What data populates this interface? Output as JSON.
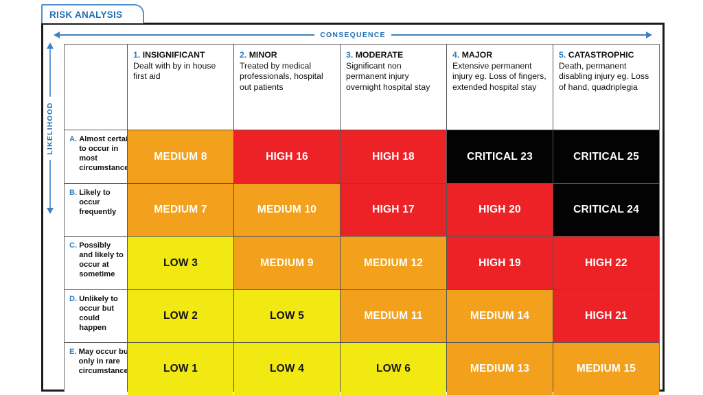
{
  "tab": {
    "label": "RISK ANALYSIS"
  },
  "axes": {
    "consequence": "CONSEQUENCE",
    "likelihood": "LIKELIHOOD"
  },
  "columns": [
    {
      "num": "1.",
      "title": "INSIGNIFICANT",
      "desc": "Dealt with by in house first aid"
    },
    {
      "num": "2.",
      "title": "MINOR",
      "desc": "Treated by medical professionals, hospital out patients"
    },
    {
      "num": "3.",
      "title": "MODERATE",
      "desc": "Significant non permanent injury overnight hospital stay"
    },
    {
      "num": "4.",
      "title": "MAJOR",
      "desc": "Extensive permanent injury  eg. Loss of fingers, extended hospital stay"
    },
    {
      "num": "5.",
      "title": "CATASTROPHIC",
      "desc": "Death, permanent disabling injury eg. Loss of hand, quadriplegia"
    }
  ],
  "rows": [
    {
      "num": "A.",
      "text": "Almost certain to occur in most circumstances"
    },
    {
      "num": "B.",
      "text": "Likely to occur frequently"
    },
    {
      "num": "C.",
      "text": "Possibly and likely to occur at sometime"
    },
    {
      "num": "D.",
      "text": "Unlikely to occur but could happen"
    },
    {
      "num": "E.",
      "text": "May occur but only in rare circumstances"
    }
  ],
  "legend_colors": {
    "low": "#f2e913",
    "medium": "#f3a01c",
    "high": "#ed2227",
    "critical": "#030303",
    "accent_blue": "#1f6fb4",
    "frame": "#1a1a1a"
  },
  "chart_data": {
    "type": "heatmap",
    "title": "RISK ANALYSIS",
    "xlabel": "CONSEQUENCE",
    "ylabel": "LIKELIHOOD",
    "categories_x": [
      "1. INSIGNIFICANT",
      "2. MINOR",
      "3. MODERATE",
      "4. MAJOR",
      "5. CATASTROPHIC"
    ],
    "categories_y": [
      "A. Almost certain",
      "B. Likely",
      "C. Possibly",
      "D. Unlikely",
      "E. May occur"
    ],
    "legend": [
      "LOW",
      "MEDIUM",
      "HIGH",
      "CRITICAL"
    ],
    "cells": [
      [
        {
          "level": "MEDIUM",
          "score": 8,
          "label": "MEDIUM 8",
          "color": "#f3a01c"
        },
        {
          "level": "HIGH",
          "score": 16,
          "label": "HIGH 16",
          "color": "#ed2227"
        },
        {
          "level": "HIGH",
          "score": 18,
          "label": "HIGH 18",
          "color": "#ed2227"
        },
        {
          "level": "CRITICAL",
          "score": 23,
          "label": "CRITICAL 23",
          "color": "#030303"
        },
        {
          "level": "CRITICAL",
          "score": 25,
          "label": "CRITICAL 25",
          "color": "#030303"
        }
      ],
      [
        {
          "level": "MEDIUM",
          "score": 7,
          "label": "MEDIUM 7",
          "color": "#f3a01c"
        },
        {
          "level": "MEDIUM",
          "score": 10,
          "label": "MEDIUM 10",
          "color": "#f3a01c"
        },
        {
          "level": "HIGH",
          "score": 17,
          "label": "HIGH 17",
          "color": "#ed2227"
        },
        {
          "level": "HIGH",
          "score": 20,
          "label": "HIGH 20",
          "color": "#ed2227"
        },
        {
          "level": "CRITICAL",
          "score": 24,
          "label": "CRITICAL 24",
          "color": "#030303"
        }
      ],
      [
        {
          "level": "LOW",
          "score": 3,
          "label": "LOW 3",
          "color": "#f2e913"
        },
        {
          "level": "MEDIUM",
          "score": 9,
          "label": "MEDIUM 9",
          "color": "#f3a01c"
        },
        {
          "level": "MEDIUM",
          "score": 12,
          "label": "MEDIUM 12",
          "color": "#f3a01c"
        },
        {
          "level": "HIGH",
          "score": 19,
          "label": "HIGH 19",
          "color": "#ed2227"
        },
        {
          "level": "HIGH",
          "score": 22,
          "label": "HIGH 22",
          "color": "#ed2227"
        }
      ],
      [
        {
          "level": "LOW",
          "score": 2,
          "label": "LOW 2",
          "color": "#f2e913"
        },
        {
          "level": "LOW",
          "score": 5,
          "label": "LOW 5",
          "color": "#f2e913"
        },
        {
          "level": "MEDIUM",
          "score": 11,
          "label": "MEDIUM 11",
          "color": "#f3a01c"
        },
        {
          "level": "MEDIUM",
          "score": 14,
          "label": "MEDIUM 14",
          "color": "#f3a01c"
        },
        {
          "level": "HIGH",
          "score": 21,
          "label": "HIGH 21",
          "color": "#ed2227"
        }
      ],
      [
        {
          "level": "LOW",
          "score": 1,
          "label": "LOW 1",
          "color": "#f2e913"
        },
        {
          "level": "LOW",
          "score": 4,
          "label": "LOW 4",
          "color": "#f2e913"
        },
        {
          "level": "LOW",
          "score": 6,
          "label": "LOW 6",
          "color": "#f2e913"
        },
        {
          "level": "MEDIUM",
          "score": 13,
          "label": "MEDIUM 13",
          "color": "#f3a01c"
        },
        {
          "level": "MEDIUM",
          "score": 15,
          "label": "MEDIUM 15",
          "color": "#f3a01c"
        }
      ]
    ]
  }
}
